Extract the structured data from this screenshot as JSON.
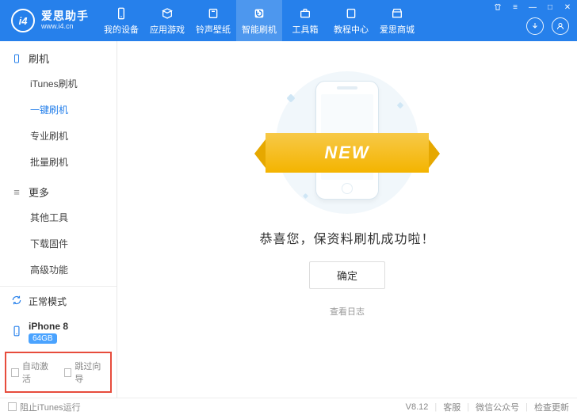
{
  "header": {
    "logo_initials": "i4",
    "logo_title": "爱思助手",
    "logo_sub": "www.i4.cn",
    "nav": [
      {
        "label": "我的设备",
        "icon": "phone"
      },
      {
        "label": "应用游戏",
        "icon": "apps"
      },
      {
        "label": "铃声壁纸",
        "icon": "music"
      },
      {
        "label": "智能刷机",
        "icon": "refresh",
        "active": true
      },
      {
        "label": "工具箱",
        "icon": "toolbox"
      },
      {
        "label": "教程中心",
        "icon": "book"
      },
      {
        "label": "爱思商城",
        "icon": "store"
      }
    ],
    "right_buttons": {
      "download": "download",
      "user": "user"
    }
  },
  "sidebar": {
    "section1": {
      "title": "刷机",
      "items": [
        "iTunes刷机",
        "一键刷机",
        "专业刷机",
        "批量刷机"
      ],
      "active_index": 1
    },
    "section2": {
      "title": "更多",
      "items": [
        "其他工具",
        "下载固件",
        "高级功能"
      ]
    },
    "status_label": "正常模式",
    "device": {
      "name": "iPhone 8",
      "capacity": "64GB"
    },
    "checkboxes": {
      "auto_activate": "自动激活",
      "skip_wizard": "跳过向导"
    }
  },
  "main": {
    "ribbon_text": "NEW",
    "success_message": "恭喜您，保资料刷机成功啦！",
    "ok_button": "确定",
    "view_log": "查看日志"
  },
  "footer": {
    "block_itunes": "阻止iTunes运行",
    "version": "V8.12",
    "support": "客服",
    "wechat": "微信公众号",
    "check_update": "检查更新"
  }
}
